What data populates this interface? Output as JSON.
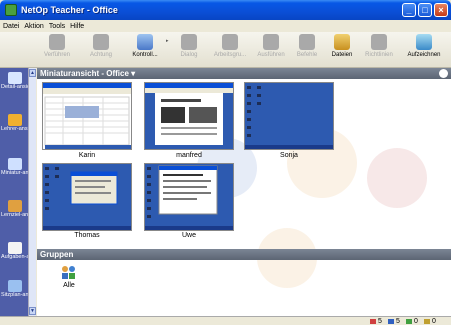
{
  "window": {
    "title": "NetOp Teacher - Office"
  },
  "menu": [
    "Datei",
    "Aktion",
    "Tools",
    "Hilfe"
  ],
  "toolbar": {
    "buttons": [
      {
        "label": "Verführen",
        "icon": "demonstrate-icon",
        "enabled": false
      },
      {
        "label": "Achtung",
        "icon": "attention-icon",
        "enabled": false
      },
      {
        "label": "Kontroll...",
        "icon": "control-icon",
        "enabled": true
      },
      {
        "label": "Dialog",
        "icon": "chat-icon",
        "enabled": false
      },
      {
        "label": "Arbeitsgru...",
        "icon": "workgroup-icon",
        "enabled": false
      },
      {
        "label": "Ausführen",
        "icon": "run-icon",
        "enabled": false
      },
      {
        "label": "Befehle",
        "icon": "commands-icon",
        "enabled": false
      },
      {
        "label": "Dateien",
        "icon": "files-icon",
        "enabled": true
      },
      {
        "label": "Richtlinien",
        "icon": "policies-icon",
        "enabled": false
      },
      {
        "label": "Aufzeichnen",
        "icon": "record-icon",
        "enabled": true
      }
    ]
  },
  "sidebar": {
    "items": [
      {
        "label": "Detail-ansicht",
        "icon": "detail-view-icon"
      },
      {
        "label": "Lehrer-ansicht",
        "icon": "teacher-view-icon"
      },
      {
        "label": "Miniatur-ansicht",
        "icon": "thumbnail-view-icon"
      },
      {
        "label": "Lernziel-ansicht",
        "icon": "goals-view-icon"
      },
      {
        "label": "Aufgaben-ansicht",
        "icon": "assignment-view-icon"
      },
      {
        "label": "Sitzplan-ansicht",
        "icon": "seating-view-icon"
      }
    ]
  },
  "main": {
    "header": "Miniaturansicht - Office",
    "students": [
      {
        "name": "Karin",
        "screen": "spreadsheet"
      },
      {
        "name": "manfred",
        "screen": "document"
      },
      {
        "name": "Sonja",
        "screen": "desktop"
      },
      {
        "name": "Thomas",
        "screen": "desktop-window"
      },
      {
        "name": "Uwe",
        "screen": "document"
      }
    ],
    "groups_header": "Gruppen",
    "groups": [
      {
        "name": "Alle",
        "icon": "group-icon"
      }
    ]
  },
  "status": {
    "items": [
      {
        "value": "5",
        "icon": "students-icon",
        "color": "#d04040"
      },
      {
        "value": "5",
        "icon": "monitors-icon",
        "color": "#3060c0"
      },
      {
        "value": "0",
        "icon": "checked-icon",
        "color": "#40a040"
      },
      {
        "value": "0",
        "icon": "handup-icon",
        "color": "#c0a030"
      }
    ]
  },
  "colors": {
    "titlebar": "#0a4fd6",
    "sidebar": "#4f5ea8",
    "pane_header": "#6b7483",
    "desktop_blue": "#2d5ab0"
  }
}
